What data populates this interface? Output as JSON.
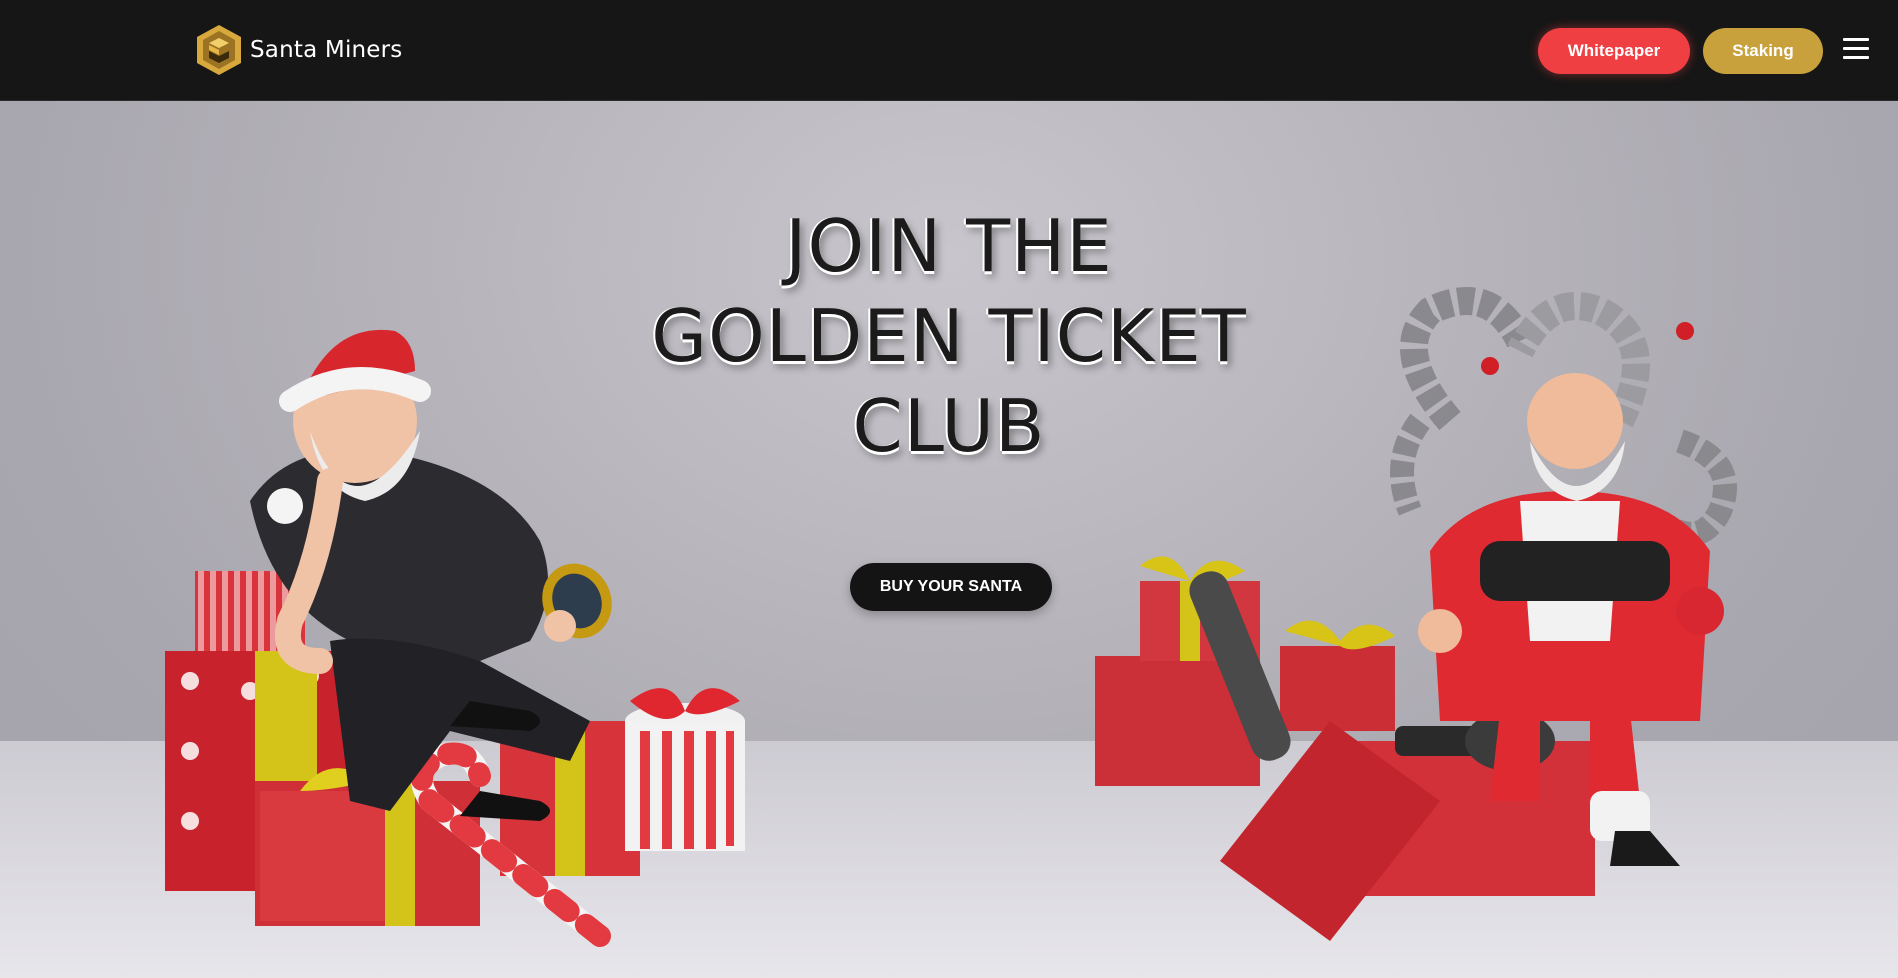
{
  "header": {
    "brand_name": "Santa Miners",
    "logo_icon": "hexagon-s-logo-icon",
    "whitepaper_label": "Whitepaper",
    "staking_label": "Staking",
    "menu_icon": "hamburger-menu-icon"
  },
  "hero": {
    "headline_line1": "JOIN THE",
    "headline_line2": "GOLDEN TICKET",
    "headline_line3": "CLUB",
    "cta_label": "BUY YOUR SANTA"
  },
  "colors": {
    "nav_bg": "#161616",
    "whitepaper_button": "#ef3f43",
    "staking_button": "#c9a13c",
    "cta_button": "#141414"
  }
}
